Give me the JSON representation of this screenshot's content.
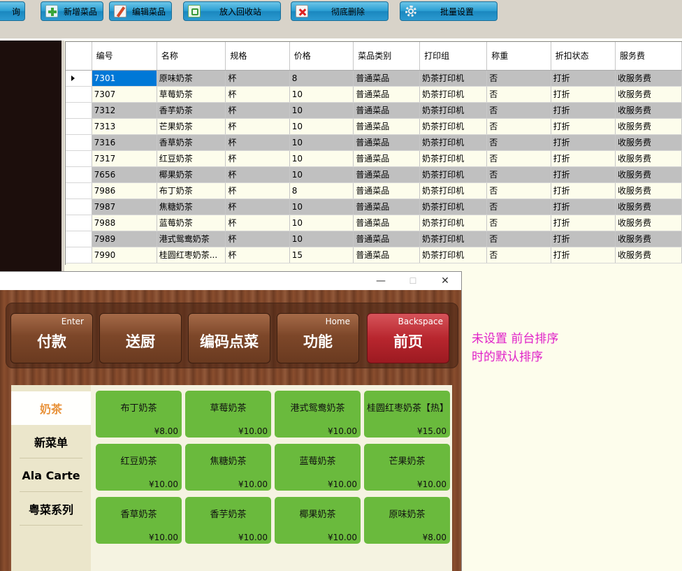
{
  "toolbar": {
    "partial_left_label": "询",
    "add_label": "新增菜品",
    "edit_label": "编辑菜品",
    "recycle_label": "放入回收站",
    "delete_label": "彻底删除",
    "batch_label": "批量设置"
  },
  "grid": {
    "headers": [
      "编号",
      "名称",
      "规格",
      "价格",
      "菜品类别",
      "打印组",
      "称重",
      "折扣状态",
      "服务费"
    ],
    "rows": [
      [
        "7301",
        "原味奶茶",
        "杯",
        "8",
        "普通菜品",
        "奶茶打印机",
        "否",
        "打折",
        "收服务费"
      ],
      [
        "7307",
        "草莓奶茶",
        "杯",
        "10",
        "普通菜品",
        "奶茶打印机",
        "否",
        "打折",
        "收服务费"
      ],
      [
        "7312",
        "香芋奶茶",
        "杯",
        "10",
        "普通菜品",
        "奶茶打印机",
        "否",
        "打折",
        "收服务费"
      ],
      [
        "7313",
        "芒果奶茶",
        "杯",
        "10",
        "普通菜品",
        "奶茶打印机",
        "否",
        "打折",
        "收服务费"
      ],
      [
        "7316",
        "香草奶茶",
        "杯",
        "10",
        "普通菜品",
        "奶茶打印机",
        "否",
        "打折",
        "收服务费"
      ],
      [
        "7317",
        "红豆奶茶",
        "杯",
        "10",
        "普通菜品",
        "奶茶打印机",
        "否",
        "打折",
        "收服务费"
      ],
      [
        "7656",
        "椰果奶茶",
        "杯",
        "10",
        "普通菜品",
        "奶茶打印机",
        "否",
        "打折",
        "收服务费"
      ],
      [
        "7986",
        "布丁奶茶",
        "杯",
        "8",
        "普通菜品",
        "奶茶打印机",
        "否",
        "打折",
        "收服务费"
      ],
      [
        "7987",
        "焦糖奶茶",
        "杯",
        "10",
        "普通菜品",
        "奶茶打印机",
        "否",
        "打折",
        "收服务费"
      ],
      [
        "7988",
        "蓝莓奶茶",
        "杯",
        "10",
        "普通菜品",
        "奶茶打印机",
        "否",
        "打折",
        "收服务费"
      ],
      [
        "7989",
        "港式鸳鸯奶茶",
        "杯",
        "10",
        "普通菜品",
        "奶茶打印机",
        "否",
        "打折",
        "收服务费"
      ],
      [
        "7990",
        "桂圆红枣奶茶...",
        "杯",
        "15",
        "普通菜品",
        "奶茶打印机",
        "否",
        "打折",
        "收服务费"
      ]
    ]
  },
  "window": {
    "minimize_label": "—",
    "maximize_label": "☐",
    "close_label": "✕",
    "func_buttons": [
      {
        "label": "付款",
        "key": "Enter"
      },
      {
        "label": "送厨",
        "key": ""
      },
      {
        "label": "编码点菜",
        "key": ""
      },
      {
        "label": "功能",
        "key": "Home"
      },
      {
        "label": "前页",
        "key": "Backspace"
      }
    ],
    "categories": [
      "奶茶",
      "新菜单",
      "Ala Carte",
      "粤菜系列"
    ],
    "dishes": [
      {
        "name": "布丁奶茶",
        "price": "¥8.00"
      },
      {
        "name": "草莓奶茶",
        "price": "¥10.00"
      },
      {
        "name": "港式鸳鸯奶茶",
        "price": "¥10.00"
      },
      {
        "name": "桂圆红枣奶茶【热】",
        "price": "¥15.00"
      },
      {
        "name": "红豆奶茶",
        "price": "¥10.00"
      },
      {
        "name": "焦糖奶茶",
        "price": "¥10.00"
      },
      {
        "name": "蓝莓奶茶",
        "price": "¥10.00"
      },
      {
        "name": "芒果奶茶",
        "price": "¥10.00"
      },
      {
        "name": "香草奶茶",
        "price": "¥10.00"
      },
      {
        "name": "香芋奶茶",
        "price": "¥10.00"
      },
      {
        "name": "椰果奶茶",
        "price": "¥10.00"
      },
      {
        "name": "原味奶茶",
        "price": "¥8.00"
      }
    ]
  },
  "note": {
    "line1": "未设置 前台排序",
    "line2": "时的默认排序"
  },
  "colors": {
    "accent_blue": "#2b9fd3",
    "selected_cell": "#0078d7",
    "dish_green": "#6aba3d",
    "active_category": "#e8923a",
    "note_magenta": "#e020c8",
    "page_red_button": "#b8262e"
  }
}
